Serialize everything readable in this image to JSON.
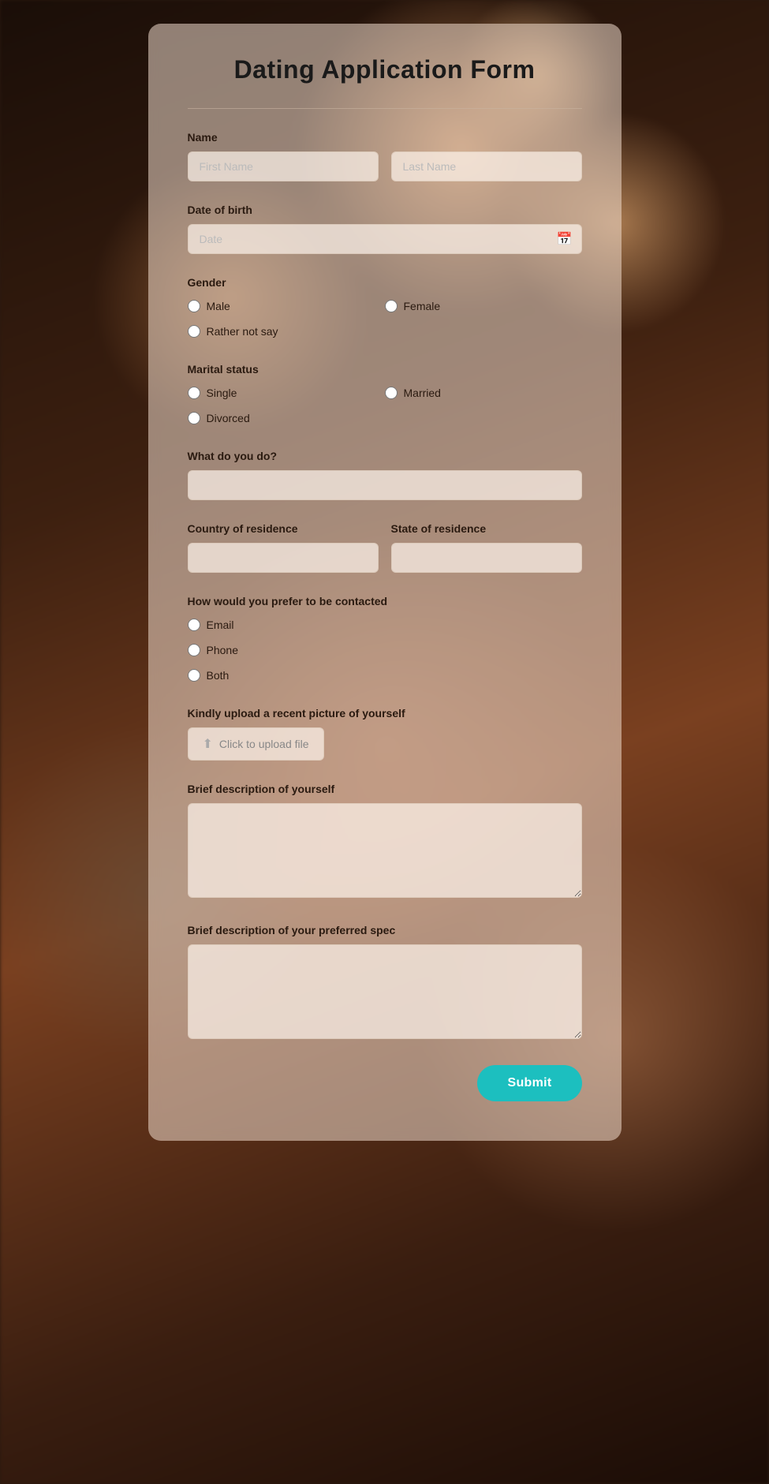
{
  "form": {
    "title": "Dating Application Form",
    "name": {
      "label": "Name",
      "first_placeholder": "First Name",
      "last_placeholder": "Last Name"
    },
    "dob": {
      "label": "Date of birth",
      "placeholder": "Date"
    },
    "gender": {
      "label": "Gender",
      "options": [
        {
          "label": "Male",
          "value": "male"
        },
        {
          "label": "Female",
          "value": "female"
        },
        {
          "label": "Rather not say",
          "value": "rather_not_say"
        }
      ]
    },
    "marital_status": {
      "label": "Marital status",
      "options": [
        {
          "label": "Single",
          "value": "single"
        },
        {
          "label": "Married",
          "value": "married"
        },
        {
          "label": "Divorced",
          "value": "divorced"
        }
      ]
    },
    "occupation": {
      "label": "What do you do?"
    },
    "country": {
      "label": "Country of residence"
    },
    "state": {
      "label": "State of residence"
    },
    "contact": {
      "label": "How would you prefer to be contacted",
      "options": [
        {
          "label": "Email",
          "value": "email"
        },
        {
          "label": "Phone",
          "value": "phone"
        },
        {
          "label": "Both",
          "value": "both"
        }
      ]
    },
    "photo": {
      "label": "Kindly upload a recent picture of yourself",
      "upload_text": "Click to upload file"
    },
    "self_description": {
      "label": "Brief description of yourself"
    },
    "preferred_spec": {
      "label": "Brief description of your preferred spec"
    },
    "submit_label": "Submit"
  }
}
